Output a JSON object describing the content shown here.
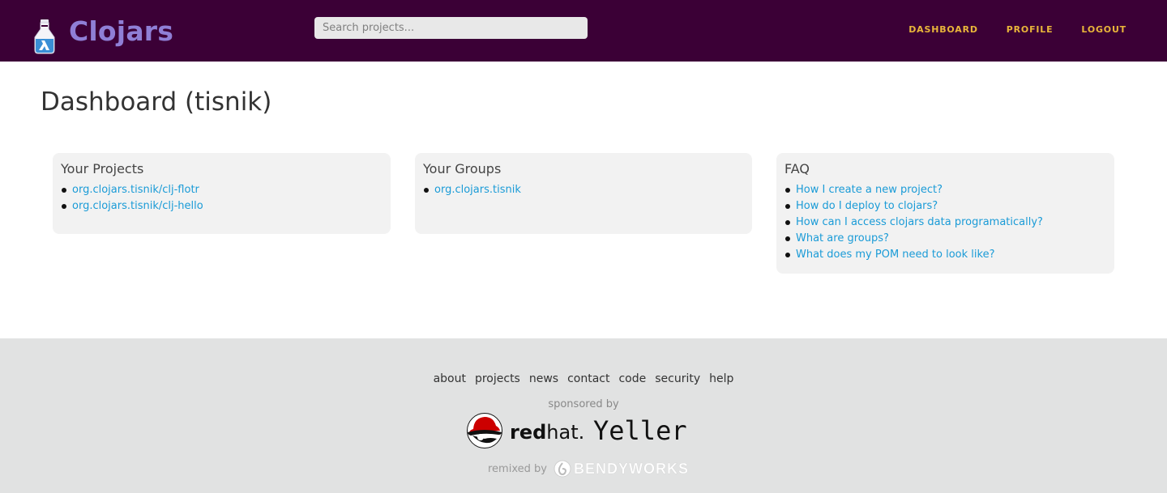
{
  "header": {
    "brand": "Clojars",
    "search_placeholder": "Search projects...",
    "nav": [
      {
        "label": "DASHBOARD"
      },
      {
        "label": "PROFILE"
      },
      {
        "label": "LOGOUT"
      }
    ],
    "colors": {
      "bar": "#3b0036",
      "brand": "#8f7fd6",
      "nav": "#e9b53a"
    }
  },
  "main": {
    "title": "Dashboard (tisnik)",
    "panels": {
      "projects": {
        "heading": "Your Projects",
        "items": [
          "org.clojars.tisnik/clj-flotr",
          "org.clojars.tisnik/clj-hello"
        ]
      },
      "groups": {
        "heading": "Your Groups",
        "items": [
          "org.clojars.tisnik"
        ]
      },
      "faq": {
        "heading": "FAQ",
        "items": [
          "How I create a new project?",
          "How do I deploy to clojars?",
          "How can I access clojars data programatically?",
          "What are groups?",
          "What does my POM need to look like?"
        ]
      }
    },
    "link_color": "#1a9bd7"
  },
  "footer": {
    "links": [
      "about",
      "projects",
      "news",
      "contact",
      "code",
      "security",
      "help"
    ],
    "sponsored_by": "sponsored by",
    "sponsors": {
      "redhat_bold": "red",
      "redhat_regular": "hat.",
      "yeller": "Yeller"
    },
    "remixed_by": "remixed by",
    "bendyworks": "BENDYWORKS"
  }
}
